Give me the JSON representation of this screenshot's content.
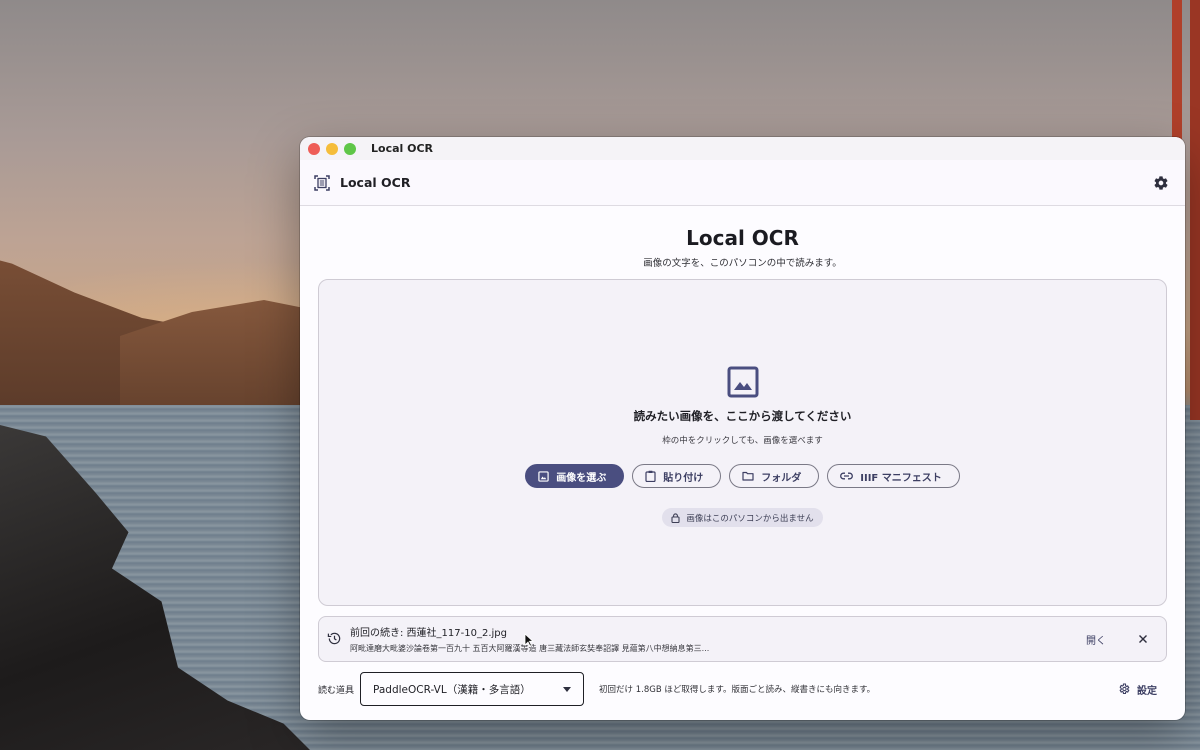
{
  "window": {
    "title": "Local OCR"
  },
  "appbar": {
    "title": "Local OCR",
    "brand_icon": "document-scan-icon",
    "settings_icon": "gear-icon"
  },
  "main": {
    "title": "Local OCR",
    "subtitle": "画像の文字を、このパソコンの中で読みます。"
  },
  "dropzone": {
    "icon": "image-icon",
    "heading": "読みたい画像を、ここから渡してください",
    "hint": "枠の中をクリックしても、画像を選べます",
    "buttons": {
      "choose_image": "画像を選ぶ",
      "paste": "貼り付け",
      "folder": "フォルダ",
      "iiif": "IIIF マニフェスト"
    },
    "privacy_note": "画像はこのパソコンから出ません"
  },
  "resume": {
    "title": "前回の続き: 西蓮社_117-10_2.jpg",
    "preview": "阿毗達磨大毗婆沙論卷第一百九十 五百大阿羅漢等造 唐三藏法師玄奘奉詔譯 見蘊第八中想納息第三...",
    "open_label": "開く"
  },
  "bottom": {
    "tool_label": "読む道具",
    "selected_model": "PaddleOCR-VL（漢籍・多言語）",
    "model_note": "初回だけ 1.8GB ほど取得します。版面ごと読み、縦書きにも向きます。",
    "settings_label": "設定"
  },
  "colors": {
    "accent": "#4a4e80",
    "surface": "#f4f2f8",
    "window_bg": "#fdfcff"
  }
}
